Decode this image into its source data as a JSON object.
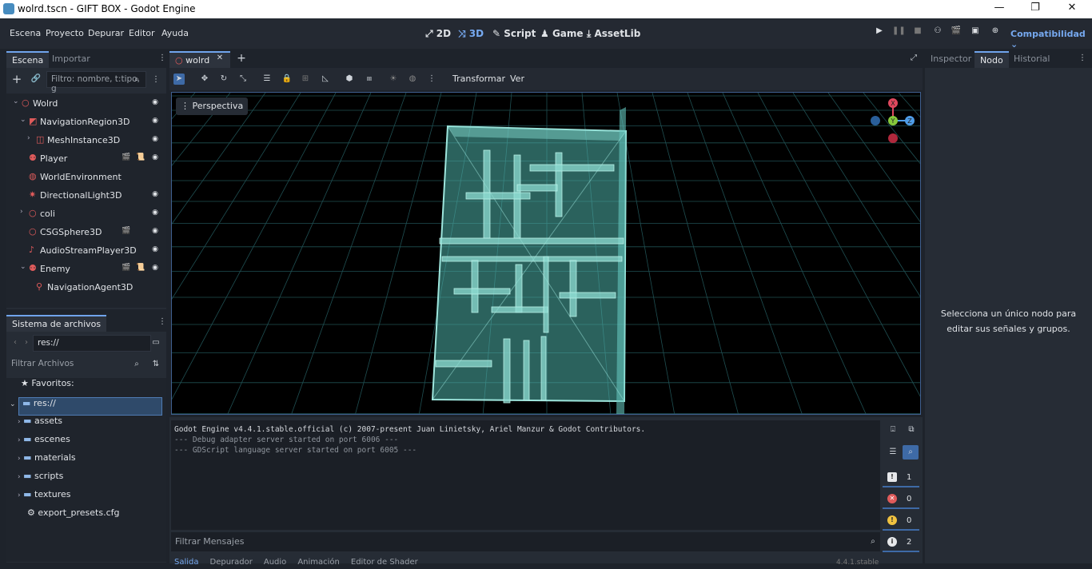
{
  "window": {
    "title": "wolrd.tscn - GIFT BOX - Godot Engine",
    "min": "—",
    "max": "❐",
    "close": "✕"
  },
  "menu": [
    "Escena",
    "Proyecto",
    "Depurar",
    "Editor",
    "Ayuda"
  ],
  "workspaces": [
    {
      "label": "2D",
      "active": false
    },
    {
      "label": "3D",
      "active": true
    },
    {
      "label": "Script",
      "active": false
    },
    {
      "label": "Game",
      "active": false
    },
    {
      "label": "AssetLib",
      "active": false
    }
  ],
  "renderer": "Compatibilidad",
  "scene_dock": {
    "tabs": [
      "Escena",
      "Importar"
    ],
    "filter_placeholder": "Filtro: nombre, t:tipo, g",
    "nodes": [
      {
        "name": "Wolrd",
        "depth": 0,
        "arrow": "⌄",
        "icon": "circle",
        "color": "#e05b5b",
        "badges": [],
        "eye": true
      },
      {
        "name": "NavigationRegion3D",
        "depth": 1,
        "arrow": "⌄",
        "icon": "navregion",
        "color": "#e05b5b",
        "badges": [],
        "eye": true
      },
      {
        "name": "MeshInstance3D",
        "depth": 2,
        "arrow": "›",
        "icon": "mesh",
        "color": "#e05b5b",
        "badges": [],
        "eye": true
      },
      {
        "name": "Player",
        "depth": 1,
        "arrow": "",
        "icon": "character",
        "color": "#e05b5b",
        "badges": [
          "🎬",
          "📜"
        ],
        "eye": true
      },
      {
        "name": "WorldEnvironment",
        "depth": 1,
        "arrow": "",
        "icon": "globe",
        "color": "#e05b5b",
        "badges": [],
        "eye": false
      },
      {
        "name": "DirectionalLight3D",
        "depth": 1,
        "arrow": "",
        "icon": "light",
        "color": "#e05b5b",
        "badges": [],
        "eye": true
      },
      {
        "name": "coli",
        "depth": 1,
        "arrow": "›",
        "icon": "circle",
        "color": "#e05b5b",
        "badges": [],
        "eye": true
      },
      {
        "name": "CSGSphere3D",
        "depth": 1,
        "arrow": "",
        "icon": "circle",
        "color": "#e05b5b",
        "badges": [
          "🎬"
        ],
        "eye": true
      },
      {
        "name": "AudioStreamPlayer3D",
        "depth": 1,
        "arrow": "",
        "icon": "audio",
        "color": "#e05b5b",
        "badges": [],
        "eye": true
      },
      {
        "name": "Enemy",
        "depth": 1,
        "arrow": "⌄",
        "icon": "character",
        "color": "#e05b5b",
        "badges": [
          "🎬",
          "📜"
        ],
        "eye": true
      },
      {
        "name": "NavigationAgent3D",
        "depth": 2,
        "arrow": "",
        "icon": "pin",
        "color": "#e05b5b",
        "badges": [],
        "eye": false
      }
    ]
  },
  "filesystem": {
    "title": "Sistema de archivos",
    "path": "res://",
    "filter_placeholder": "Filtrar Archivos",
    "favorites": "Favoritos:",
    "root": "res://",
    "folders": [
      "assets",
      "escenes",
      "materials",
      "scripts",
      "textures"
    ],
    "file": "export_presets.cfg"
  },
  "editor_tabs": [
    {
      "label": "wolrd",
      "active": true
    }
  ],
  "toolbar": {
    "transform": "Transformar",
    "view": "Ver"
  },
  "viewport": {
    "label": "Perspectiva",
    "gizmo": {
      "x": "X",
      "y": "Y",
      "z": "Z"
    }
  },
  "console": {
    "lines": [
      "Godot Engine v4.4.1.stable.official (c) 2007-present Juan Linietsky, Ariel Manzur & Godot Contributors.",
      "--- Debug adapter server started on port 6006 ---",
      "--- GDScript language server started on port 6005 ---"
    ],
    "filter_placeholder": "Filtrar Mensajes",
    "counts": [
      {
        "icon": "!",
        "value": "1",
        "color": "#ffffff",
        "bg": "#3a3f47"
      },
      {
        "icon": "✕",
        "value": "0",
        "color": "#ffffff",
        "bg": "#e05b5b"
      },
      {
        "icon": "!",
        "value": "0",
        "color": "#2a2a2a",
        "bg": "#f0c240"
      },
      {
        "icon": "i",
        "value": "2",
        "color": "#ffffff",
        "bg": "#3a3f47"
      }
    ],
    "bottom_tabs": [
      "Salida",
      "Depurador",
      "Audio",
      "Animación",
      "Editor de Shader"
    ],
    "version": "4.4.1.stable"
  },
  "inspector": {
    "tabs": [
      "Inspector",
      "Nodo",
      "Historial"
    ],
    "active_tab": "Nodo",
    "message": "Selecciona un único nodo para editar sus señales y grupos."
  }
}
